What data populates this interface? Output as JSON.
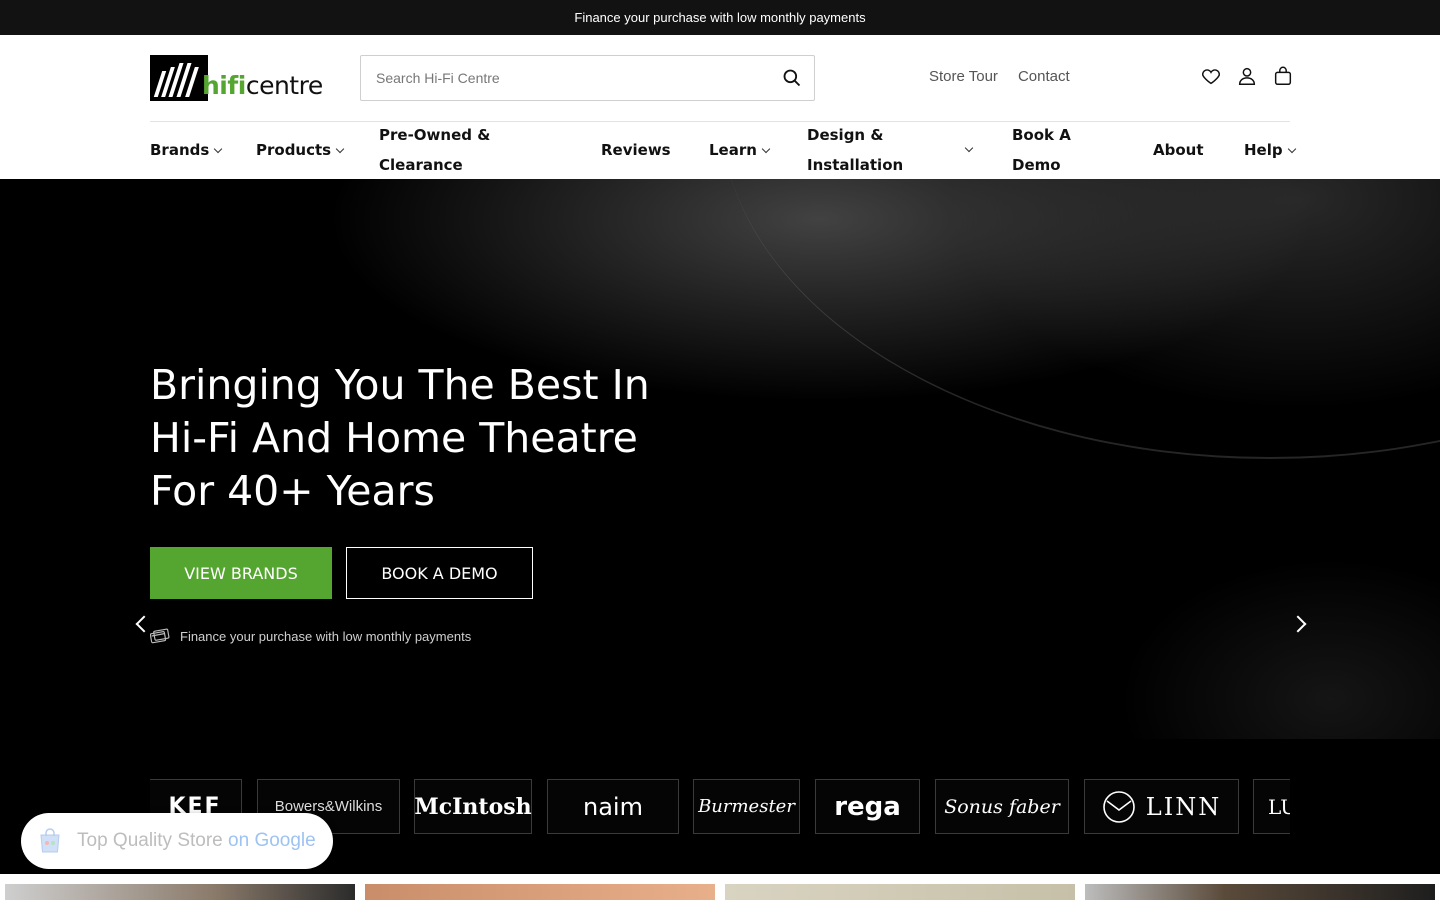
{
  "announcement": {
    "text": "Finance your purchase with low monthly payments"
  },
  "header": {
    "logo": {
      "part1": "hifi",
      "part2": "centre"
    },
    "search": {
      "placeholder": "Search Hi-Fi Centre"
    },
    "links": [
      "Store Tour",
      "Contact"
    ],
    "icons": [
      "heart-icon",
      "user-icon",
      "bag-icon"
    ]
  },
  "nav": {
    "items": [
      {
        "label": "Brands",
        "dropdown": true
      },
      {
        "label": "Products",
        "dropdown": true
      },
      {
        "line1": "Pre-Owned &",
        "line2": "Clearance",
        "dropdown": false
      },
      {
        "label": "Reviews",
        "dropdown": false
      },
      {
        "label": "Learn",
        "dropdown": true
      },
      {
        "line1": "Design &",
        "line2": "Installation",
        "dropdown": true
      },
      {
        "line1": "Book A",
        "line2": "Demo",
        "dropdown": false
      },
      {
        "label": "About",
        "dropdown": false
      },
      {
        "label": "Help",
        "dropdown": true
      }
    ]
  },
  "hero": {
    "headline": "Bringing You The Best In Hi-Fi And Home Theatre For 40+ Years",
    "primary_cta": "VIEW BRANDS",
    "secondary_cta": "BOOK A DEMO",
    "finance_note": "Finance your purchase with low monthly payments"
  },
  "brands": [
    "KEF",
    "Bowers&Wilkins",
    "McIntosh",
    "naim",
    "Burmester",
    "rega",
    "Sonus faber",
    "LINN",
    "LU"
  ],
  "google_badge": {
    "label": "Top Quality Store",
    "suffix": "on Google"
  },
  "colors": {
    "accent": "#55a630",
    "announce_bg": "#121212",
    "hero_bg": "#000000"
  }
}
